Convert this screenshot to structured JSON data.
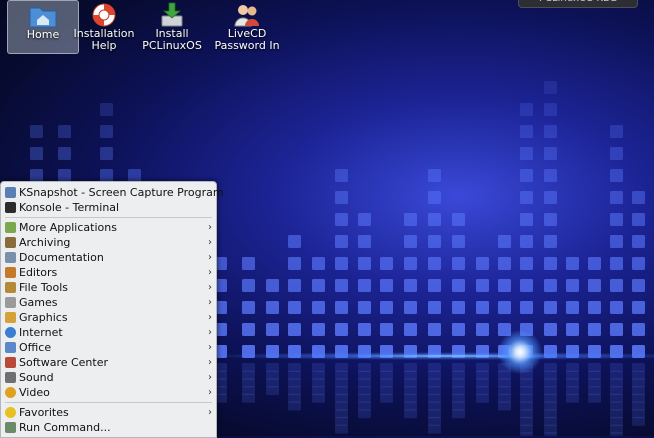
{
  "desktop": {
    "icons": [
      {
        "label_line1": "Home",
        "label_line2": "",
        "icon": "home-folder-icon",
        "selected": true
      },
      {
        "label_line1": "Installation",
        "label_line2": "Help",
        "icon": "lifebuoy-icon",
        "selected": false
      },
      {
        "label_line1": "Install",
        "label_line2": "PCLinuxOS",
        "icon": "install-drive-icon",
        "selected": false
      },
      {
        "label_line1": "LiveCD",
        "label_line2": "Password In",
        "icon": "users-icon",
        "selected": false
      }
    ],
    "tray_hint": "PCLinuxOS KDE"
  },
  "menu": {
    "top_items": [
      {
        "label": "KSnapshot - Screen Capture Program",
        "icon": "camera-icon",
        "color": "#5a7fb4"
      },
      {
        "label": "Konsole - Terminal",
        "icon": "terminal-icon",
        "color": "#2b2b2b"
      }
    ],
    "categories": [
      {
        "label": "More Applications",
        "icon": "applications-icon",
        "color": "#7aa84a"
      },
      {
        "label": "Archiving",
        "icon": "archive-icon",
        "color": "#8a6c3a"
      },
      {
        "label": "Documentation",
        "icon": "documentation-icon",
        "color": "#7a8fa8"
      },
      {
        "label": "Editors",
        "icon": "editor-icon",
        "color": "#c47a2a"
      },
      {
        "label": "File Tools",
        "icon": "file-tools-icon",
        "color": "#b5893a"
      },
      {
        "label": "Games",
        "icon": "games-icon",
        "color": "#9a9a9a"
      },
      {
        "label": "Graphics",
        "icon": "graphics-icon",
        "color": "#d5a23a"
      },
      {
        "label": "Internet",
        "icon": "internet-icon",
        "color": "#3a7fd0"
      },
      {
        "label": "Office",
        "icon": "office-icon",
        "color": "#5a88c8"
      },
      {
        "label": "Software Center",
        "icon": "software-center-icon",
        "color": "#b84a3a"
      },
      {
        "label": "Sound",
        "icon": "sound-icon",
        "color": "#707070"
      },
      {
        "label": "Video",
        "icon": "video-icon",
        "color": "#e0a020"
      }
    ],
    "bottom_items": [
      {
        "label": "Favorites",
        "icon": "star-icon",
        "color": "#e8c020",
        "submenu": true
      },
      {
        "label": "Run Command...",
        "icon": "run-command-icon",
        "color": "#6a8a6a",
        "submenu": false
      }
    ],
    "arrow_glyph": "›"
  }
}
